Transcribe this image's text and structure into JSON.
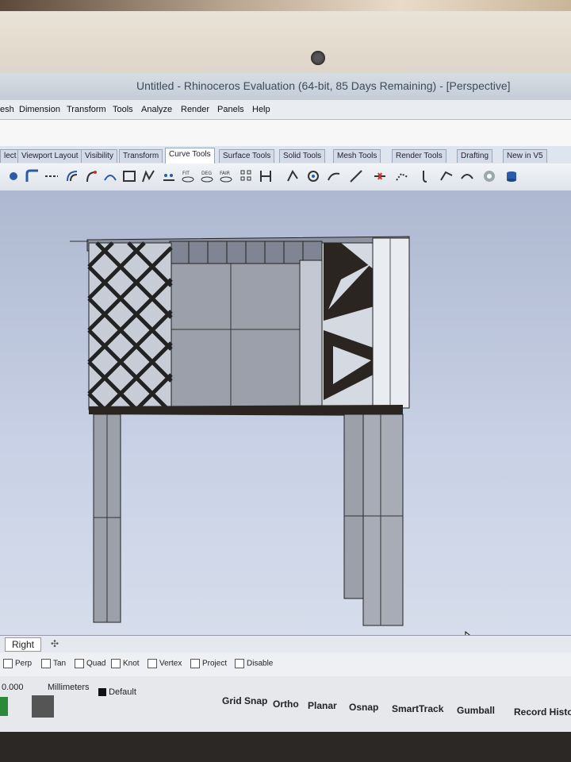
{
  "window": {
    "title": "Untitled - Rhinoceros Evaluation (64-bit, 85 Days Remaining) - [Perspective]"
  },
  "menu": [
    "esh",
    "Dimension",
    "Transform",
    "Tools",
    "Analyze",
    "Render",
    "Panels",
    "Help"
  ],
  "toolbar_tabs": [
    {
      "label": "lect",
      "active": false
    },
    {
      "label": "Viewport Layout",
      "active": false
    },
    {
      "label": "Visibility",
      "active": false
    },
    {
      "label": "Transform",
      "active": false
    },
    {
      "label": "Curve Tools",
      "active": true
    },
    {
      "label": "Surface Tools",
      "active": false
    },
    {
      "label": "Solid Tools",
      "active": false
    },
    {
      "label": "Mesh Tools",
      "active": false
    },
    {
      "label": "Render Tools",
      "active": false
    },
    {
      "label": "Drafting",
      "active": false
    },
    {
      "label": "New in V5",
      "active": false
    }
  ],
  "toolbar_icons": [
    {
      "name": "point-icon",
      "caption": ""
    },
    {
      "name": "fillet-curves-icon",
      "caption": ""
    },
    {
      "name": "blend-curves-icon",
      "caption": ""
    },
    {
      "name": "offset-curve-icon",
      "caption": ""
    },
    {
      "name": "extend-curve-icon",
      "caption": ""
    },
    {
      "name": "match-curve-icon",
      "caption": ""
    },
    {
      "name": "fit-curve-icon",
      "caption": "FIT"
    },
    {
      "name": "deg-curve-icon",
      "caption": "DEG"
    },
    {
      "name": "fair-curve-icon",
      "caption": "FAIR"
    },
    {
      "name": "control-points-icon",
      "caption": ""
    },
    {
      "name": "edit-points-icon",
      "caption": ""
    },
    {
      "name": "insert-knot-icon",
      "caption": ""
    },
    {
      "name": "remove-knot-icon",
      "caption": ""
    },
    {
      "name": "curve-tool-icon",
      "caption": ""
    },
    {
      "name": "polyline-icon",
      "caption": ""
    },
    {
      "name": "curve-seam-icon",
      "caption": ""
    },
    {
      "name": "arc-tool-icon",
      "caption": ""
    },
    {
      "name": "circle-tool-icon",
      "caption": ""
    },
    {
      "name": "cylinder-icon",
      "caption": ""
    }
  ],
  "viewport": {
    "name": "Perspective"
  },
  "view_tabs": {
    "active": "Right",
    "add_icon": "add-view-icon"
  },
  "osnap": [
    {
      "label": "Perp",
      "checked": false
    },
    {
      "label": "Tan",
      "checked": false
    },
    {
      "label": "Quad",
      "checked": false
    },
    {
      "label": "Knot",
      "checked": false
    },
    {
      "label": "Vertex",
      "checked": false
    },
    {
      "label": "Project",
      "checked": false
    },
    {
      "label": "Disable",
      "checked": false
    }
  ],
  "status": {
    "coord": "0.000",
    "units": "Millimeters",
    "layer": "Default",
    "buttons": [
      "Grid Snap",
      "Ortho",
      "Planar",
      "Osnap",
      "SmartTrack",
      "Gumball",
      "Record Histo"
    ]
  },
  "colors": {
    "accent": "#2b5aa8",
    "viewport_bg": "#c9d2e6",
    "model_dark": "#2a2520",
    "model_light": "#9ca0ab"
  }
}
